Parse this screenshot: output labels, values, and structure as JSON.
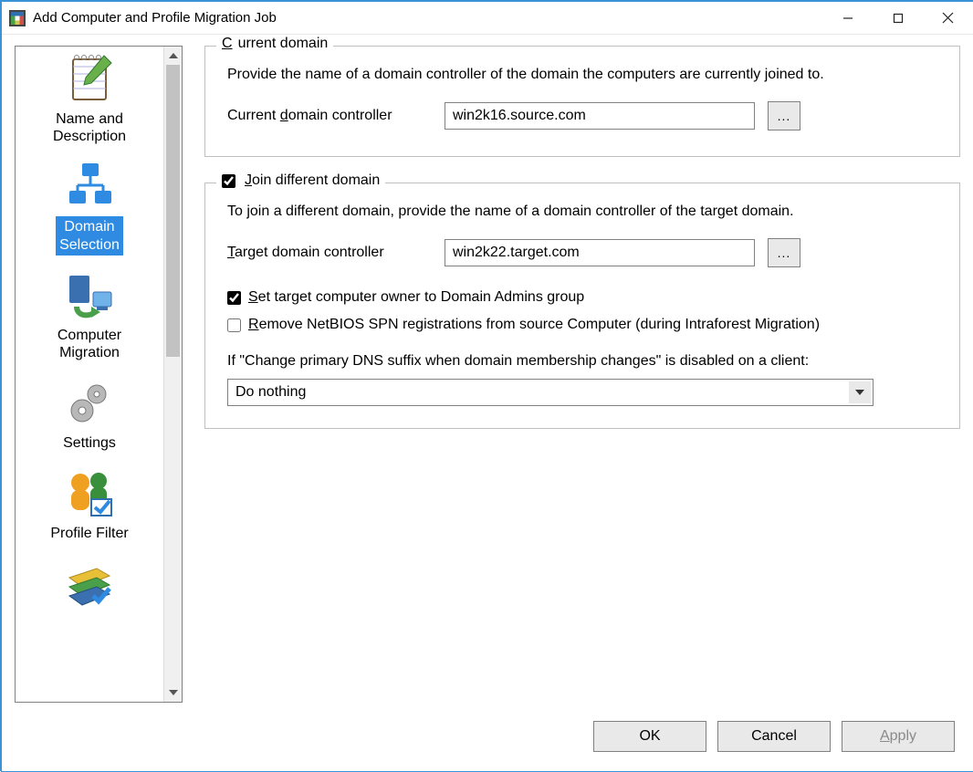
{
  "window": {
    "title": "Add Computer and Profile Migration Job"
  },
  "sidebar": {
    "items": [
      {
        "label": "Name and\nDescription"
      },
      {
        "label": "Domain\nSelection",
        "selected": true
      },
      {
        "label": "Computer\nMigration"
      },
      {
        "label": "Settings"
      },
      {
        "label": "Profile Filter"
      },
      {
        "label": ""
      }
    ]
  },
  "current_domain": {
    "legend_html": "<span class='u'>C</span>urrent domain",
    "description": "Provide the name of a domain controller of the domain the computers are currently joined to.",
    "field_label_html": "Current <span class='u'>d</span>omain controller",
    "value": "win2k16.source.com",
    "browse": "..."
  },
  "join": {
    "checked": true,
    "legend_html": "<span class='u'>J</span>oin different domain",
    "description": "To join a different domain, provide the name of a domain controller of the target domain.",
    "field_label_html": "<span class='u'>T</span>arget domain controller",
    "value": "win2k22.target.com",
    "browse": "...",
    "set_owner": {
      "checked": true,
      "label_html": "<span class='u'>S</span>et target computer owner to Domain Admins group"
    },
    "remove_spn": {
      "checked": false,
      "label_html": "<span class='u'>R</span>emove NetBIOS SPN registrations from source Computer (during Intraforest Migration)"
    },
    "dns_note": "If \"Change primary DNS suffix when domain membership changes\" is disabled on a client:",
    "dns_action": "Do nothing"
  },
  "footer": {
    "ok": "OK",
    "cancel": "Cancel",
    "apply_html": "<span class='u'>A</span>pply"
  }
}
